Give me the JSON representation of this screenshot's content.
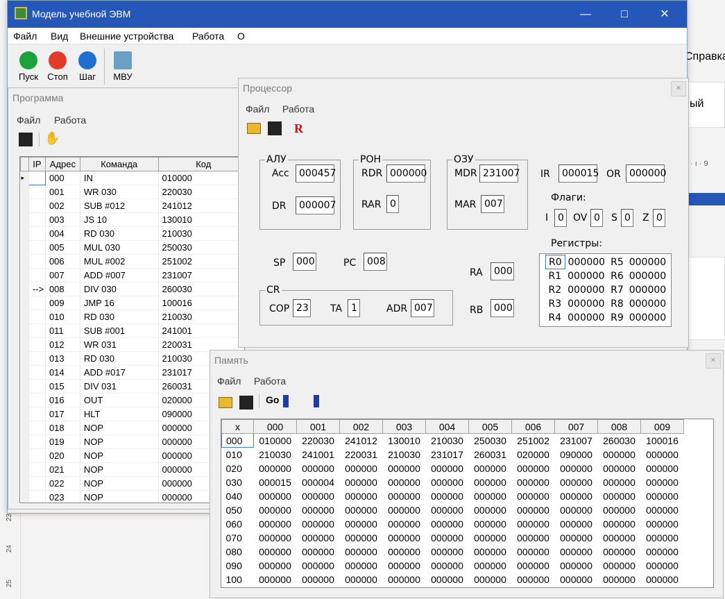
{
  "app": {
    "title": "Модель учебной ЭВМ",
    "menu": [
      "Файл",
      "Вид",
      "Внешние устройства",
      "Работа",
      "О"
    ],
    "toolbar": {
      "run": "Пуск",
      "stop": "Стоп",
      "step": "Шаг",
      "io": "МВУ"
    },
    "colors": {
      "titlebar": "#2457b8",
      "run": "#1aa33a",
      "stop": "#e23b2b",
      "step": "#1f6fd1"
    }
  },
  "background_app": {
    "menu_help": "Справка",
    "side_text": "ый",
    "ruler": "· ı · 9",
    "ruler_left": [
      "23",
      "24",
      "25"
    ]
  },
  "program": {
    "title": "Программа",
    "menu": [
      "Файл",
      "Работа"
    ],
    "headers": [
      "IP",
      "Адрес",
      "Команда",
      "Код"
    ],
    "rows": [
      {
        "ip": "",
        "addr": "000",
        "cmd": "IN",
        "code": "010000"
      },
      {
        "ip": "",
        "addr": "001",
        "cmd": "WR 030",
        "code": "220030"
      },
      {
        "ip": "",
        "addr": "002",
        "cmd": "SUB #012",
        "code": "241012"
      },
      {
        "ip": "",
        "addr": "003",
        "cmd": "JS 10",
        "code": "130010"
      },
      {
        "ip": "",
        "addr": "004",
        "cmd": "RD 030",
        "code": "210030"
      },
      {
        "ip": "",
        "addr": "005",
        "cmd": "MUL 030",
        "code": "250030"
      },
      {
        "ip": "",
        "addr": "006",
        "cmd": "MUL #002",
        "code": "251002"
      },
      {
        "ip": "",
        "addr": "007",
        "cmd": "ADD #007",
        "code": "231007"
      },
      {
        "ip": "-->",
        "addr": "008",
        "cmd": "DIV 030",
        "code": "260030"
      },
      {
        "ip": "",
        "addr": "009",
        "cmd": "JMP 16",
        "code": "100016"
      },
      {
        "ip": "",
        "addr": "010",
        "cmd": "RD 030",
        "code": "210030"
      },
      {
        "ip": "",
        "addr": "011",
        "cmd": "SUB #001",
        "code": "241001"
      },
      {
        "ip": "",
        "addr": "012",
        "cmd": "WR 031",
        "code": "220031"
      },
      {
        "ip": "",
        "addr": "013",
        "cmd": "RD 030",
        "code": "210030"
      },
      {
        "ip": "",
        "addr": "014",
        "cmd": "ADD #017",
        "code": "231017"
      },
      {
        "ip": "",
        "addr": "015",
        "cmd": "DIV 031",
        "code": "260031"
      },
      {
        "ip": "",
        "addr": "016",
        "cmd": "OUT",
        "code": "020000"
      },
      {
        "ip": "",
        "addr": "017",
        "cmd": "HLT",
        "code": "090000"
      },
      {
        "ip": "",
        "addr": "018",
        "cmd": "NOP",
        "code": "000000"
      },
      {
        "ip": "",
        "addr": "019",
        "cmd": "NOP",
        "code": "000000"
      },
      {
        "ip": "",
        "addr": "020",
        "cmd": "NOP",
        "code": "000000"
      },
      {
        "ip": "",
        "addr": "021",
        "cmd": "NOP",
        "code": "000000"
      },
      {
        "ip": "",
        "addr": "022",
        "cmd": "NOP",
        "code": "000000"
      },
      {
        "ip": "",
        "addr": "023",
        "cmd": "NOP",
        "code": "000000"
      }
    ]
  },
  "processor": {
    "title": "Процессор",
    "menu": [
      "Файл",
      "Работа"
    ],
    "alu": {
      "title": "АЛУ",
      "acc_label": "Acc",
      "acc": "000457",
      "dr_label": "DR",
      "dr": "000007"
    },
    "ron": {
      "title": "РОН",
      "rdr_label": "RDR",
      "rdr": "000000",
      "rar_label": "RAR",
      "rar": "0"
    },
    "ozu": {
      "title": "ОЗУ",
      "mdr_label": "MDR",
      "mdr": "231007",
      "mar_label": "MAR",
      "mar": "007"
    },
    "ir_label": "IR",
    "ir": "000015",
    "or_label": "OR",
    "or": "000000",
    "flags": {
      "title": "Флаги:",
      "i_label": "I",
      "i": "0",
      "ov_label": "OV",
      "ov": "0",
      "s_label": "S",
      "s": "0",
      "z_label": "Z",
      "z": "0"
    },
    "sp_label": "SP",
    "sp": "000",
    "pc_label": "PC",
    "pc": "008",
    "ra_label": "RA",
    "ra": "000",
    "rb_label": "RB",
    "rb": "000",
    "cr": {
      "title": "CR",
      "cop_label": "COP",
      "cop": "23",
      "ta_label": "TA",
      "ta": "1",
      "adr_label": "ADR",
      "adr": "007"
    },
    "registers": {
      "title": "Регистры:",
      "rows": [
        {
          "n1": "R0",
          "v1": "000000",
          "n2": "R5",
          "v2": "000000"
        },
        {
          "n1": "R1",
          "v1": "000000",
          "n2": "R6",
          "v2": "000000"
        },
        {
          "n1": "R2",
          "v1": "000000",
          "n2": "R7",
          "v2": "000000"
        },
        {
          "n1": "R3",
          "v1": "000000",
          "n2": "R8",
          "v2": "000000"
        },
        {
          "n1": "R4",
          "v1": "000000",
          "n2": "R9",
          "v2": "000000"
        }
      ]
    }
  },
  "memory": {
    "title": "Память",
    "menu": [
      "Файл",
      "Работа"
    ],
    "headers": [
      "x",
      "000",
      "001",
      "002",
      "003",
      "004",
      "005",
      "006",
      "007",
      "008",
      "009"
    ],
    "rows": [
      {
        "h": "000",
        "c": [
          "010000",
          "220030",
          "241012",
          "130010",
          "210030",
          "250030",
          "251002",
          "231007",
          "260030",
          "100016"
        ]
      },
      {
        "h": "010",
        "c": [
          "210030",
          "241001",
          "220031",
          "210030",
          "231017",
          "260031",
          "020000",
          "090000",
          "000000",
          "000000"
        ]
      },
      {
        "h": "020",
        "c": [
          "000000",
          "000000",
          "000000",
          "000000",
          "000000",
          "000000",
          "000000",
          "000000",
          "000000",
          "000000"
        ]
      },
      {
        "h": "030",
        "c": [
          "000015",
          "000004",
          "000000",
          "000000",
          "000000",
          "000000",
          "000000",
          "000000",
          "000000",
          "000000"
        ]
      },
      {
        "h": "040",
        "c": [
          "000000",
          "000000",
          "000000",
          "000000",
          "000000",
          "000000",
          "000000",
          "000000",
          "000000",
          "000000"
        ]
      },
      {
        "h": "050",
        "c": [
          "000000",
          "000000",
          "000000",
          "000000",
          "000000",
          "000000",
          "000000",
          "000000",
          "000000",
          "000000"
        ]
      },
      {
        "h": "060",
        "c": [
          "000000",
          "000000",
          "000000",
          "000000",
          "000000",
          "000000",
          "000000",
          "000000",
          "000000",
          "000000"
        ]
      },
      {
        "h": "070",
        "c": [
          "000000",
          "000000",
          "000000",
          "000000",
          "000000",
          "000000",
          "000000",
          "000000",
          "000000",
          "000000"
        ]
      },
      {
        "h": "080",
        "c": [
          "000000",
          "000000",
          "000000",
          "000000",
          "000000",
          "000000",
          "000000",
          "000000",
          "000000",
          "000000"
        ]
      },
      {
        "h": "090",
        "c": [
          "000000",
          "000000",
          "000000",
          "000000",
          "000000",
          "000000",
          "000000",
          "000000",
          "000000",
          "000000"
        ]
      },
      {
        "h": "100",
        "c": [
          "000000",
          "000000",
          "000000",
          "000000",
          "000000",
          "000000",
          "000000",
          "000000",
          "000000",
          "000000"
        ]
      }
    ]
  }
}
